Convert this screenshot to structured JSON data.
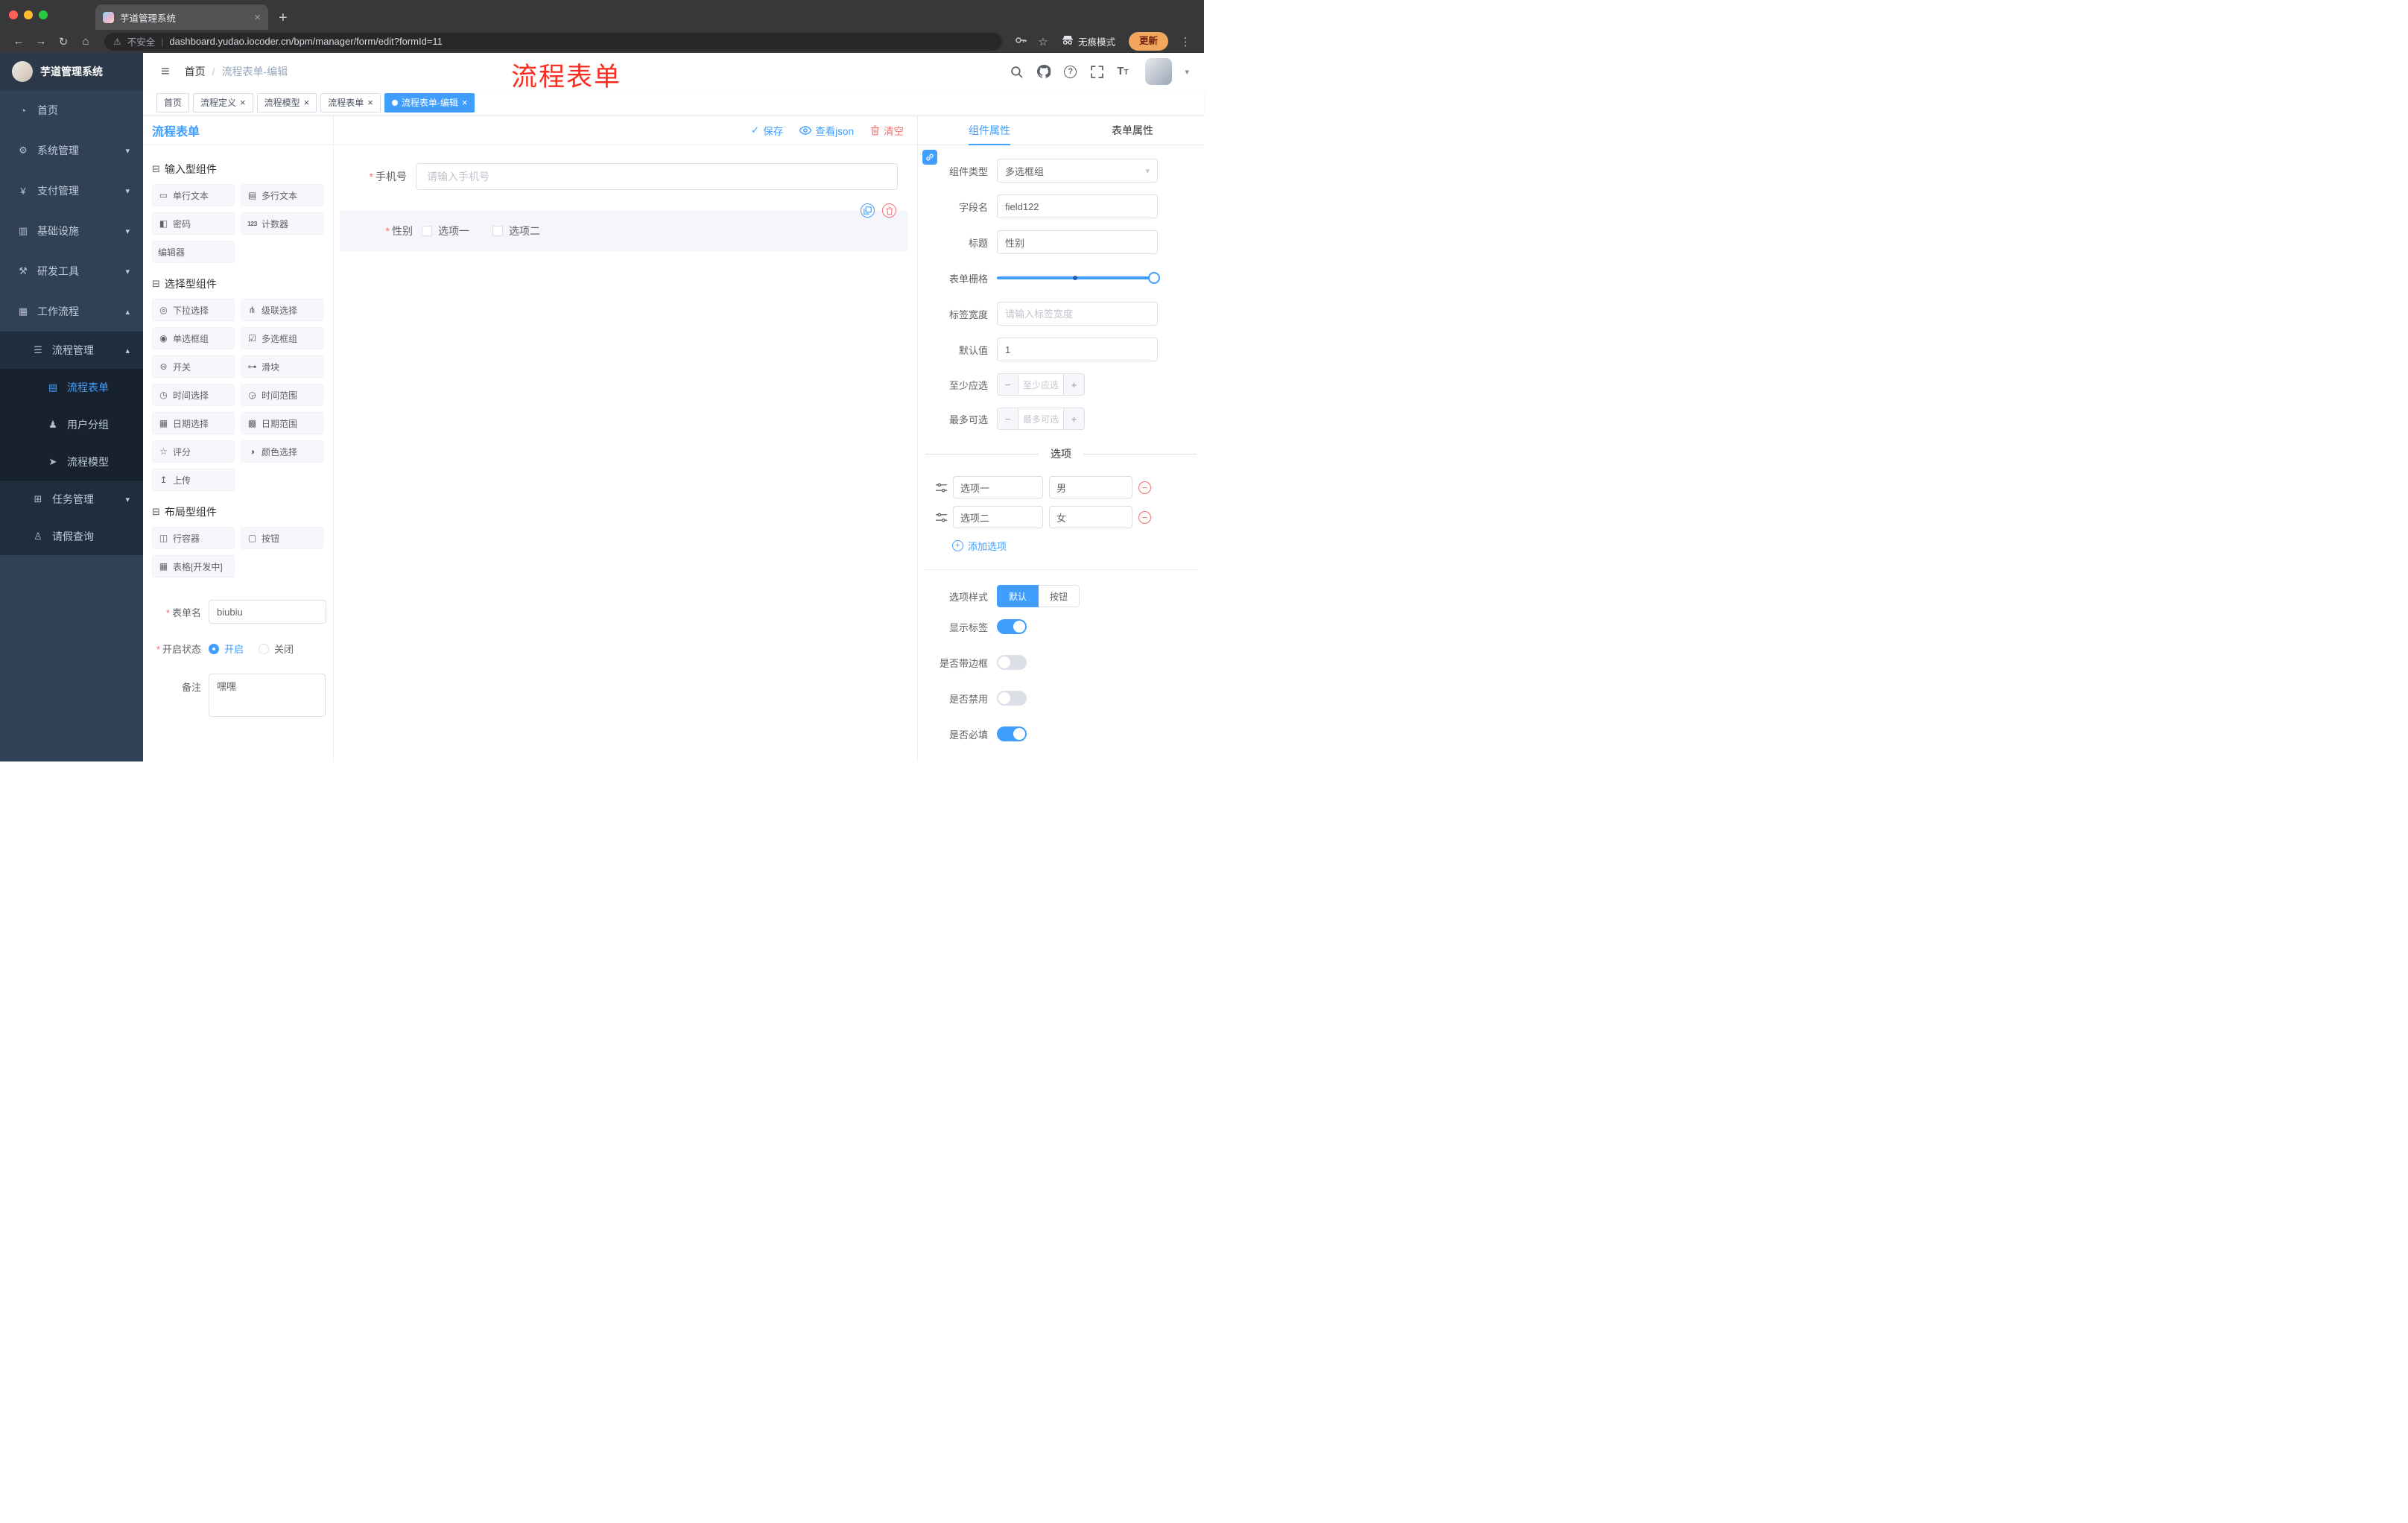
{
  "colors": {
    "accent": "#409eff",
    "danger": "#f56c6c",
    "sidebar": "#304156"
  },
  "glyphs": {
    "hamburger": "≡",
    "slash": "/",
    "pipe": "|",
    "close": "×",
    "plus": "+",
    "back": "←",
    "forward": "→",
    "reload": "↻",
    "home": "⌂",
    "warning": "⚠",
    "star": "☆",
    "kebab": "⋮",
    "caret_down": "▾",
    "caret_up": "▴",
    "check": "✓",
    "minus": "−",
    "add": "+",
    "section": "⊟",
    "help": "?",
    "text_size": "T",
    "asterisk": "*"
  },
  "browser": {
    "tab_title": "芋道管理系统",
    "security_label": "不安全",
    "url": "dashboard.yudao.iocoder.cn/bpm/manager/form/edit?formId=11",
    "incognito_label": "无痕模式",
    "update_label": "更新"
  },
  "sidebar": {
    "logo_title": "芋道管理系统",
    "items": [
      {
        "label": "首页",
        "glyph": "◔"
      },
      {
        "label": "系统管理",
        "glyph": "⚙"
      },
      {
        "label": "支付管理",
        "glyph": "¥"
      },
      {
        "label": "基础设施",
        "glyph": "▥"
      },
      {
        "label": "研发工具",
        "glyph": "⚒"
      },
      {
        "label": "工作流程",
        "glyph": "▦"
      },
      {
        "label": "流程管理",
        "glyph": "☰"
      },
      {
        "label": "流程表单",
        "glyph": "▤"
      },
      {
        "label": "用户分组",
        "glyph": "♟"
      },
      {
        "label": "流程模型",
        "glyph": "➤"
      },
      {
        "label": "任务管理",
        "glyph": "⊞"
      },
      {
        "label": "请假查询",
        "glyph": "♙"
      }
    ]
  },
  "header": {
    "breadcrumb_home": "首页",
    "breadcrumb_current": "流程表单-编辑",
    "annotation": "流程表单"
  },
  "tags": [
    {
      "label": "首页"
    },
    {
      "label": "流程定义"
    },
    {
      "label": "流程模型"
    },
    {
      "label": "流程表单"
    },
    {
      "label": "流程表单-编辑"
    }
  ],
  "designer": {
    "panel_title": "流程表单",
    "toolbar": {
      "save": "保存",
      "view_json": "查看json",
      "clear": "清空"
    },
    "groups": [
      {
        "title": "输入型组件",
        "items": [
          {
            "label": "单行文本",
            "glyph": "▭"
          },
          {
            "label": "多行文本",
            "glyph": "▤"
          },
          {
            "label": "密码",
            "glyph": "◧"
          },
          {
            "label": "计数器",
            "glyph": "123"
          },
          {
            "label": "编辑器",
            "glyph": ""
          }
        ]
      },
      {
        "title": "选择型组件",
        "items": [
          {
            "label": "下拉选择",
            "glyph": "◎"
          },
          {
            "label": "级联选择",
            "glyph": "⋔"
          },
          {
            "label": "单选框组",
            "glyph": "◉"
          },
          {
            "label": "多选框组",
            "glyph": "☑"
          },
          {
            "label": "开关",
            "glyph": "⊜"
          },
          {
            "label": "滑块",
            "glyph": "⊶"
          },
          {
            "label": "时间选择",
            "glyph": "◷"
          },
          {
            "label": "时间范围",
            "glyph": "◶"
          },
          {
            "label": "日期选择",
            "glyph": "▦"
          },
          {
            "label": "日期范围",
            "glyph": "▩"
          },
          {
            "label": "评分",
            "glyph": "☆"
          },
          {
            "label": "颜色选择",
            "glyph": "◑"
          },
          {
            "label": "上传",
            "glyph": "↥"
          }
        ]
      },
      {
        "title": "布局型组件",
        "items": [
          {
            "label": "行容器",
            "glyph": "◫"
          },
          {
            "label": "按钮",
            "glyph": "▢"
          },
          {
            "label": "表格[开发中]",
            "glyph": "▦"
          }
        ]
      }
    ],
    "form_config": {
      "name_label": "表单名",
      "name_value": "biubiu",
      "status_label": "开启状态",
      "status_on": "开启",
      "status_off": "关闭",
      "remark_label": "备注",
      "remark_value": "嘿嘿"
    },
    "canvas": {
      "phone": {
        "label": "手机号",
        "placeholder": "请输入手机号"
      },
      "gender": {
        "label": "性别",
        "option1": "选项一",
        "option2": "选项二"
      }
    },
    "props": {
      "tab_component": "组件属性",
      "tab_form": "表单属性",
      "component_type": {
        "label": "组件类型",
        "value": "多选框组"
      },
      "field_name": {
        "label": "字段名",
        "value": "field122"
      },
      "title": {
        "label": "标题",
        "value": "性别"
      },
      "grid": {
        "label": "表单栅格"
      },
      "label_width": {
        "label": "标签宽度",
        "placeholder": "请输入标签宽度"
      },
      "default_value": {
        "label": "默认值",
        "value": "1"
      },
      "min": {
        "label": "至少应选",
        "placeholder": "至少应选"
      },
      "max": {
        "label": "最多可选",
        "placeholder": "最多可选"
      },
      "options_title": "选项",
      "options": [
        {
          "label": "选项一",
          "value": "男"
        },
        {
          "label": "选项二",
          "value": "女"
        }
      ],
      "add_option": "添加选项",
      "style": {
        "label": "选项样式",
        "default": "默认",
        "button": "按钮"
      },
      "switch_show_label": "显示标签",
      "switch_border": "是否带边框",
      "switch_disabled": "是否禁用",
      "switch_required": "是否必填"
    }
  }
}
